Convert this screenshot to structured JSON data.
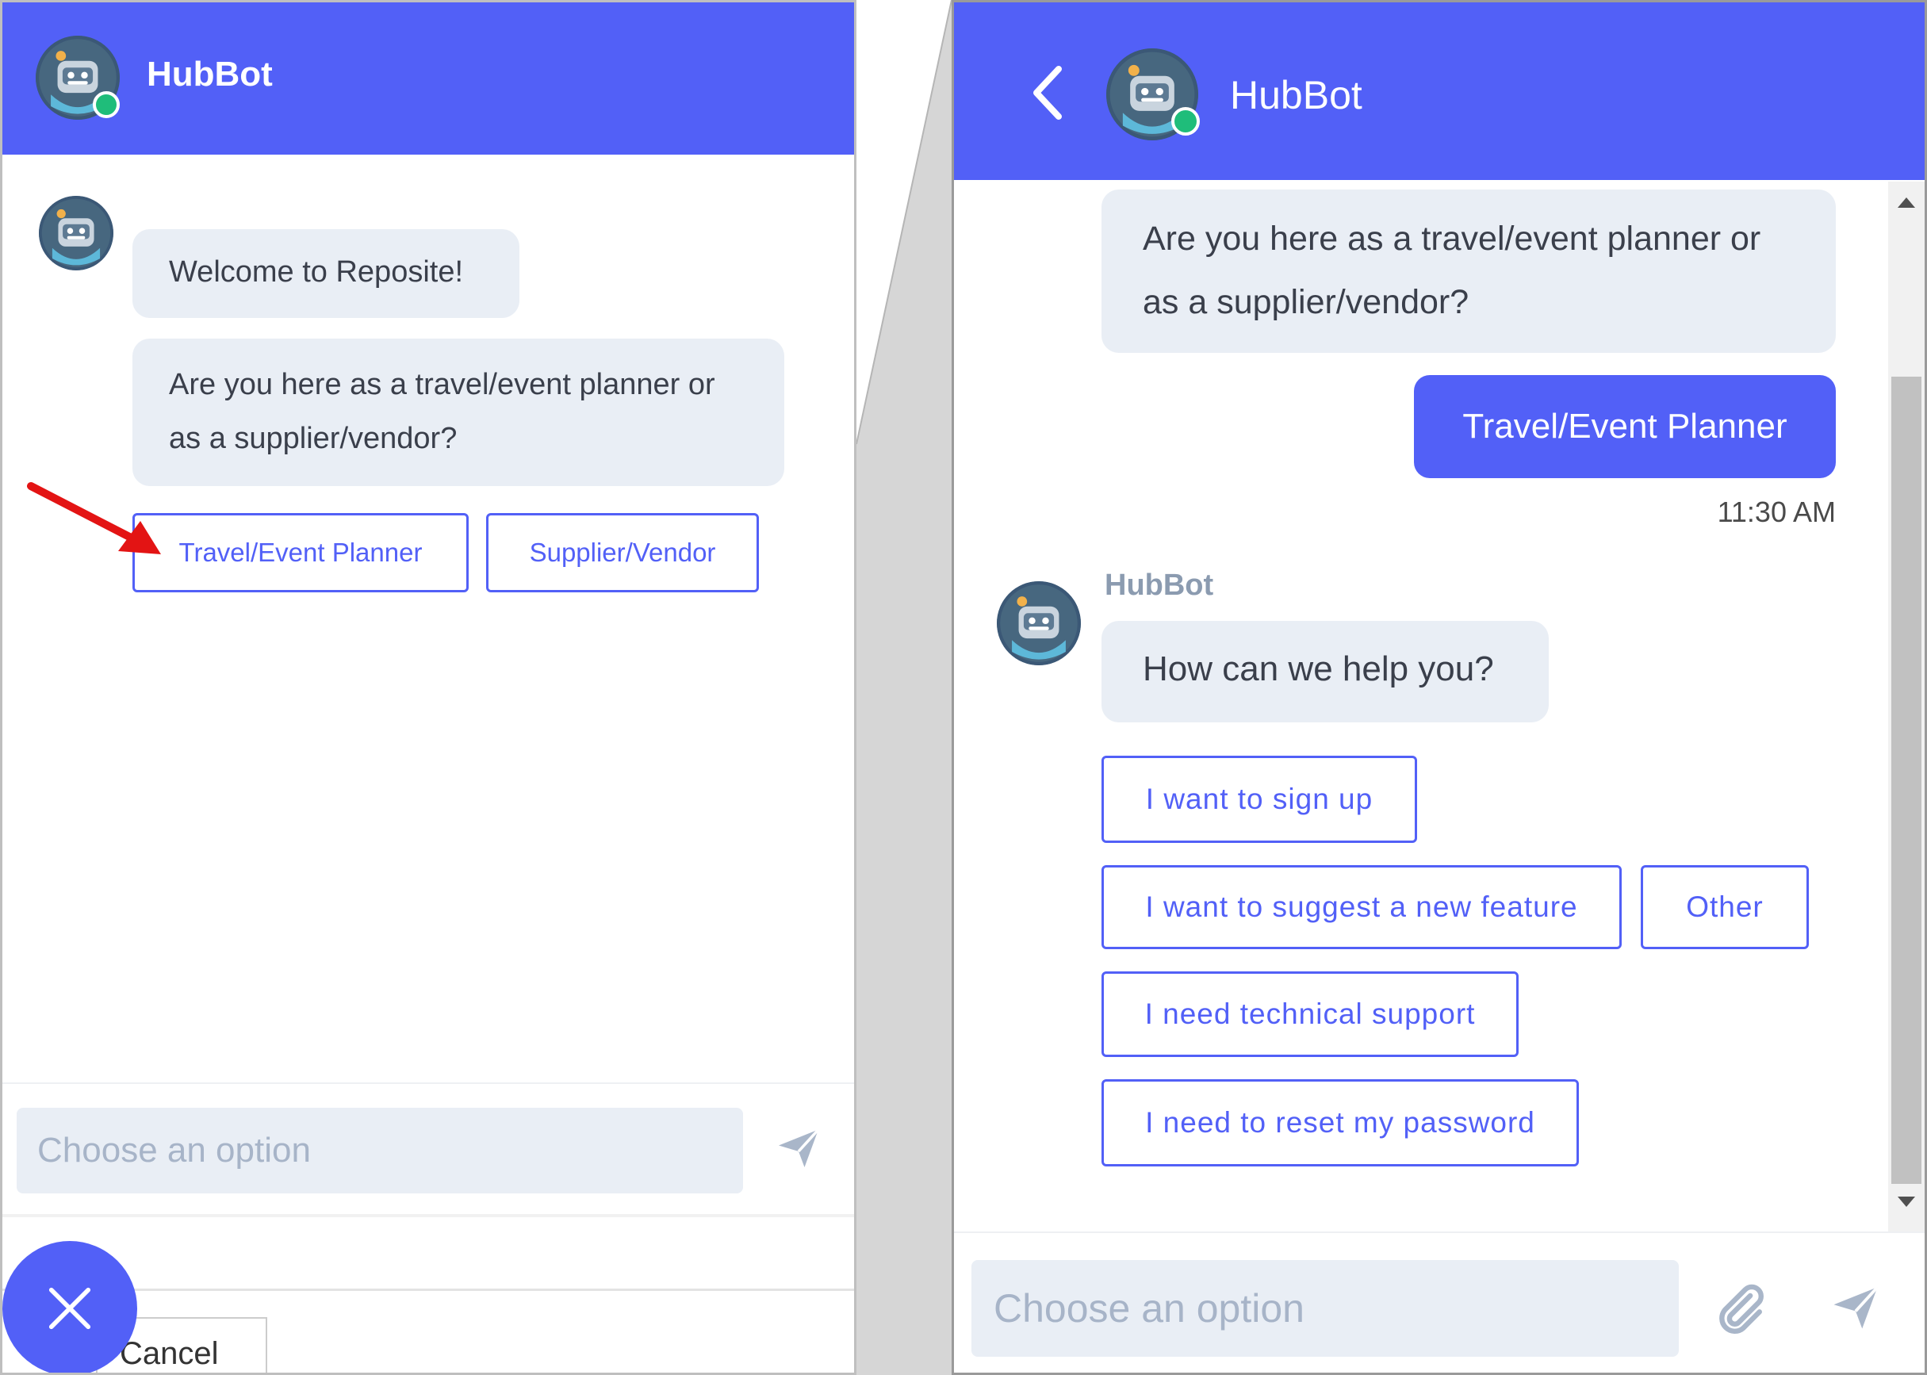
{
  "left": {
    "header": {
      "title": "HubBot"
    },
    "messages": [
      {
        "text": "Welcome to Reposite!"
      },
      {
        "text": "Are you here as a travel/event planner or as a supplier/vendor?"
      }
    ],
    "options": [
      "Travel/Event Planner",
      "Supplier/Vendor"
    ],
    "composer": {
      "placeholder": "Choose an option"
    },
    "cancel_label": "Cancel"
  },
  "right": {
    "header": {
      "title": "HubBot"
    },
    "previous_bot_message": "Are you here as a travel/event planner or as a supplier/vendor?",
    "user_message": {
      "text": "Travel/Event Planner",
      "time": "11:30 AM"
    },
    "bot_name": "HubBot",
    "bot_message": "How can we help you?",
    "options": [
      "I want to sign up",
      "I want to suggest a new feature",
      "Other",
      "I need technical support",
      "I need to reset my password"
    ],
    "composer": {
      "placeholder": "Choose an option"
    }
  },
  "colors": {
    "brand": "#5260f7",
    "bubble": "#e9eef5",
    "online": "#1fbd7a",
    "annotation_arrow": "#e31414"
  },
  "icons": [
    "bot-avatar-icon",
    "back-chevron-icon",
    "send-icon",
    "paperclip-icon",
    "close-icon",
    "red-arrow-annotation"
  ]
}
